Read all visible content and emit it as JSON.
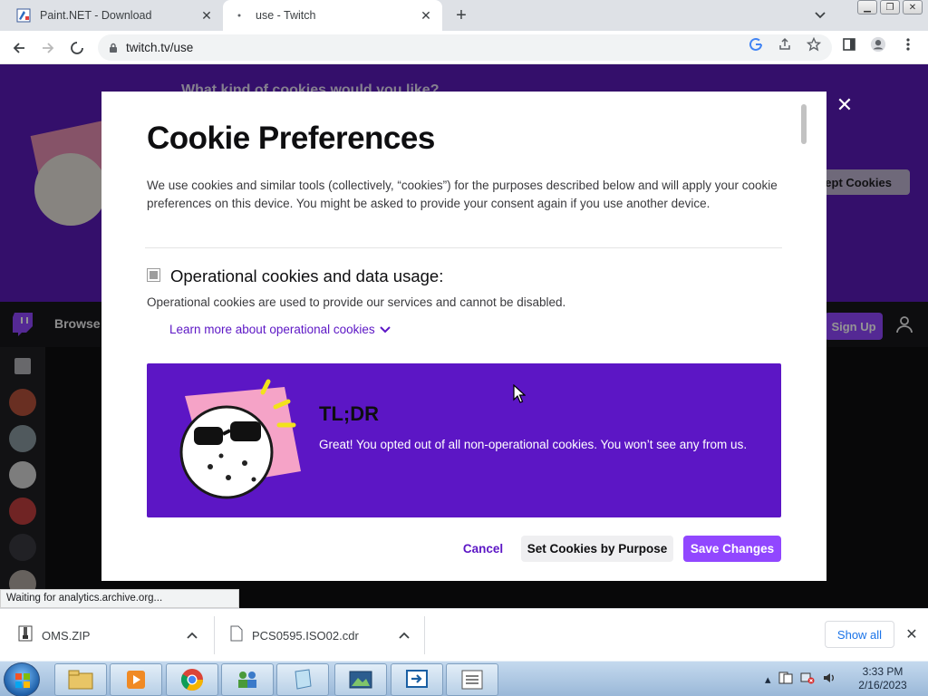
{
  "browser": {
    "tabs": [
      {
        "title": "Paint.NET - Download",
        "active": false
      },
      {
        "title": "use - Twitch",
        "active": true
      }
    ],
    "url": "twitch.tv/use",
    "status": "Waiting for analytics.archive.org..."
  },
  "background_page": {
    "banner_question": "What kind of cookies would you like?",
    "accept_button": "Accept Cookies",
    "nav_browse": "Browse",
    "signup": "Sign Up"
  },
  "modal": {
    "title": "Cookie Preferences",
    "intro": "We use cookies and similar tools (collectively, “cookies”) for the purposes described below and will apply your cookie preferences on this device. You might be asked to provide your consent again if you use another device.",
    "operational": {
      "heading": "Operational cookies and data usage:",
      "description": "Operational cookies are used to provide our services and cannot be disabled.",
      "learn_more": "Learn more about operational cookies"
    },
    "tldr": {
      "title": "TL;DR",
      "text": "Great! You opted out of all non-operational cookies. You won’t see any from us."
    },
    "buttons": {
      "cancel": "Cancel",
      "by_purpose": "Set Cookies by Purpose",
      "save": "Save Changes"
    }
  },
  "downloads": {
    "items": [
      {
        "name": "OMS.ZIP"
      },
      {
        "name": "PCS0595.ISO02.cdr"
      }
    ],
    "show_all": "Show all"
  },
  "taskbar": {
    "time": "3:33 PM",
    "date": "2/16/2023"
  },
  "colors": {
    "twitch_purple": "#9147ff",
    "tldr_purple": "#5c16c5",
    "banner_purple": "#5a1ab8"
  }
}
